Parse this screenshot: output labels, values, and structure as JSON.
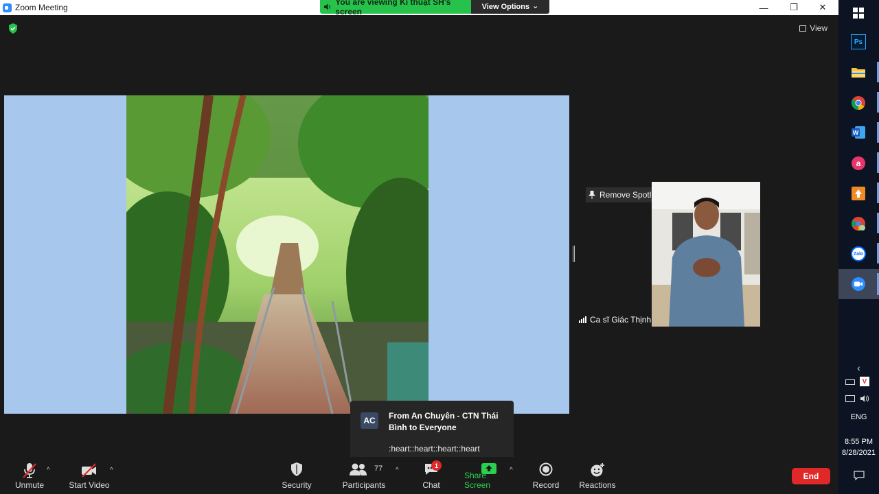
{
  "window": {
    "title": "Zoom Meeting",
    "minimize_glyph": "—",
    "restore_glyph": "❐",
    "close_glyph": "✕"
  },
  "banner": {
    "viewing_text": "You are viewing Kĩ thuật SH's screen",
    "view_options_label": "View Options",
    "view_options_caret": "⌄"
  },
  "header": {
    "view_label": "View",
    "encryption_icon": "shield-check-icon"
  },
  "participant": {
    "remove_spotlight_label": "Remove Spotlight",
    "name": "Ca sĩ Giác Thịnh"
  },
  "chat_popup": {
    "avatar_initials": "AC",
    "from": "From An Chuyên - CTN Thái Bình to Everyone",
    "message": ":heart::heart::heart::heart"
  },
  "toolbar": {
    "unmute_label": "Unmute",
    "start_video_label": "Start Video",
    "security_label": "Security",
    "participants_label": "Participants",
    "participants_count": "77",
    "chat_label": "Chat",
    "chat_badge": "1",
    "share_screen_label": "Share Screen",
    "record_label": "Record",
    "reactions_label": "Reactions",
    "end_label": "End",
    "caret": "^"
  },
  "taskbar": {
    "apps": [
      "windows-start-icon",
      "photoshop-icon",
      "file-explorer-icon",
      "chrome-icon",
      "word-icon",
      "app-a-icon",
      "app-orange-icon",
      "chrome-profile-icon",
      "zalo-icon",
      "zoom-icon"
    ],
    "ps_label": "Ps",
    "zalo_label": "Zalo",
    "lang": "ENG",
    "time": "8:55 PM",
    "date": "8/28/2021"
  },
  "colors": {
    "banner_green": "#27c24c",
    "share_bg": "#a7c7ec",
    "end_red": "#e02828",
    "share_screen_green": "#2bd051",
    "taskbar_bg": "#0c1424"
  }
}
